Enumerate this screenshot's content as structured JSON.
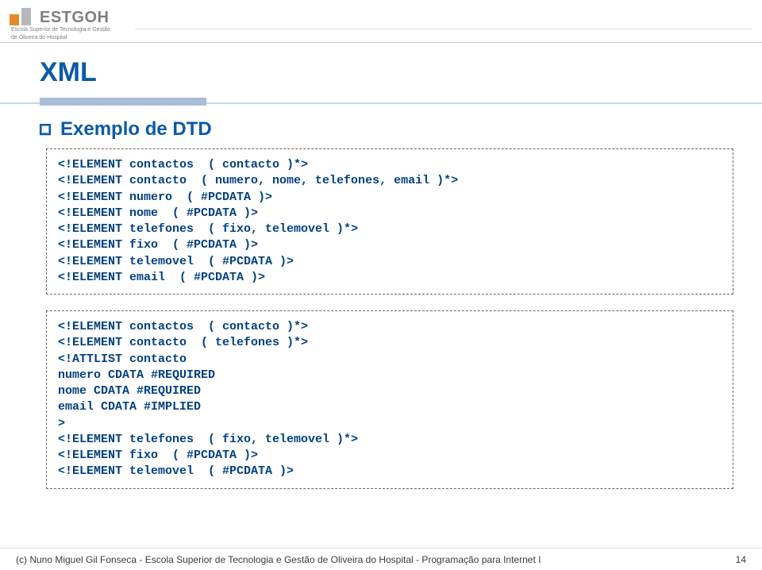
{
  "header": {
    "logo_main": "ESTGOH",
    "logo_sub1": "Escola Superior de Tecnologia e Gestão",
    "logo_sub2": "de Oliveira do Hospital"
  },
  "title": "XML",
  "section_heading": "Exemplo de DTD",
  "code_block_1": "<!ELEMENT contactos  ( contacto )*>\n<!ELEMENT contacto  ( numero, nome, telefones, email )*>\n<!ELEMENT numero  ( #PCDATA )>\n<!ELEMENT nome  ( #PCDATA )>\n<!ELEMENT telefones  ( fixo, telemovel )*>\n<!ELEMENT fixo  ( #PCDATA )>\n<!ELEMENT telemovel  ( #PCDATA )>\n<!ELEMENT email  ( #PCDATA )>",
  "code_block_2": "<!ELEMENT contactos  ( contacto )*>\n<!ELEMENT contacto  ( telefones )*>\n<!ATTLIST contacto\nnumero CDATA #REQUIRED\nnome CDATA #REQUIRED\nemail CDATA #IMPLIED\n>\n<!ELEMENT telefones  ( fixo, telemovel )*>\n<!ELEMENT fixo  ( #PCDATA )>\n<!ELEMENT telemovel  ( #PCDATA )>",
  "footer": {
    "left": "(c) Nuno Miguel Gil Fonseca  -  Escola Superior de Tecnologia e Gestão de Oliveira do Hospital  -  Programação para Internet I",
    "right": "14"
  }
}
